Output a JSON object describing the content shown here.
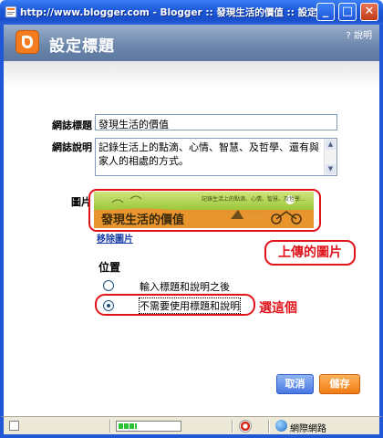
{
  "window": {
    "title": "http://www.blogger.com - Blogger :: 發現生活的價值 :: 設定標題 - Micro...",
    "min_label": "_",
    "max_label": "□",
    "close_label": "✕"
  },
  "header": {
    "title": "設定標題",
    "help_icon": "?",
    "help_label": "說明"
  },
  "form": {
    "blog_title_label": "網誌標題",
    "blog_title_value": "發現生活的價值",
    "description_label": "網誌說明",
    "description_value": "記錄生活上的點滴、心情、智慧、及哲學、還有與家人的相處的方式。",
    "image_label": "圖片",
    "banner_text": "發現生活的價值",
    "banner_subtext": "記錄生活上的點滴、心情、智慧、及哲學...",
    "remove_image_link": "移除圖片",
    "position_title": "位置",
    "options": [
      {
        "label": "輸入標題和說明之後",
        "checked": false
      },
      {
        "label": "不需要使用標題和說明",
        "checked": true
      }
    ]
  },
  "annotations": {
    "upload_callout": "上傳的圖片",
    "choose_callout": "選這個"
  },
  "buttons": {
    "cancel": "取消",
    "save": "儲存"
  },
  "status": {
    "zone": "網際網路",
    "progress_fraction": 0.3
  },
  "colors": {
    "accent": "#f47c1f",
    "annotation_red": "#e0131b",
    "header_blue": "#6b86ab"
  }
}
